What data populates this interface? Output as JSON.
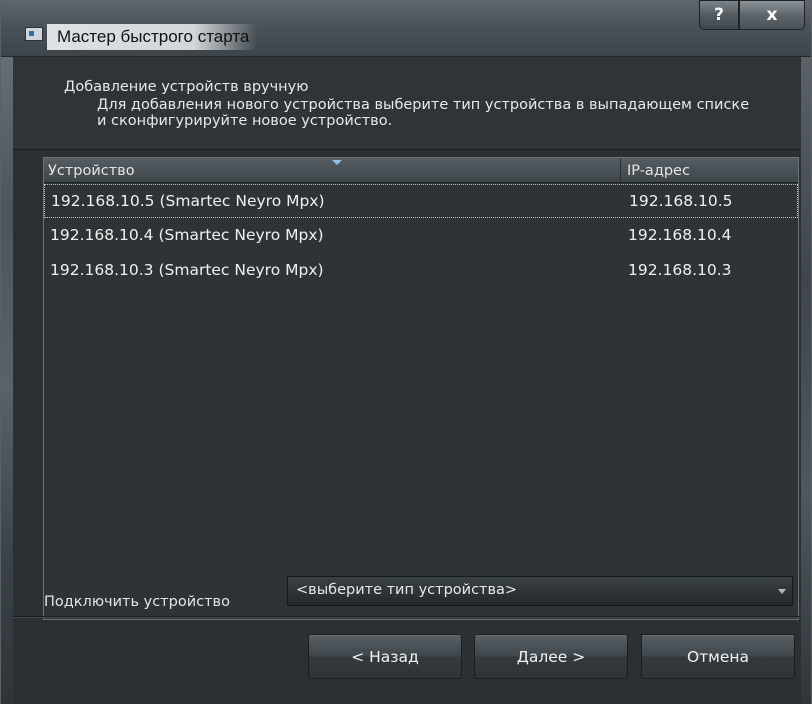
{
  "window": {
    "title": "Мастер быстрого старта",
    "help_label": "?",
    "close_label": "x"
  },
  "header": {
    "title": "Добавление устройств вручную",
    "description": "Для добавления нового устройства выберите тип устройства в выпадающем списке и сконфигурируйте новое устройство."
  },
  "table": {
    "columns": [
      "Устройство",
      "IP-адрес"
    ],
    "rows": [
      {
        "device": "192.168.10.5 (Smartec Neyro Mpx)",
        "ip": "192.168.10.5"
      },
      {
        "device": "192.168.10.4 (Smartec Neyro Mpx)",
        "ip": "192.168.10.4"
      },
      {
        "device": "192.168.10.3 (Smartec Neyro Mpx)",
        "ip": "192.168.10.3"
      }
    ]
  },
  "connect": {
    "label": "Подключить устройство",
    "selected": "<выберите тип устройства>"
  },
  "buttons": {
    "back": "< Назад",
    "next": "Далее >",
    "cancel": "Отмена"
  }
}
